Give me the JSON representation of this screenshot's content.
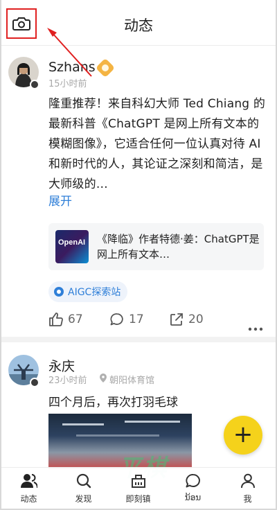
{
  "header": {
    "title": "动态",
    "camera_icon": "camera-icon",
    "highlight_color": "#e02020"
  },
  "posts": [
    {
      "username": "Szhans",
      "timestamp": "15小时前",
      "body": "隆重推荐！来自科幻大师 Ted Chiang 的最新科普《ChatGPT 是网上所有文本的模糊图像》，它适合任何一位认真对待 AI 和新时代的人，其论证之深刻和简洁，是大师级的…",
      "expand_label": "展开",
      "link_card": {
        "thumb_text": "OpenAI",
        "text": "《降临》作者特德·姜：ChatGPT是网上所有文本…"
      },
      "topic": "AIGC探索站",
      "likes": "67",
      "comments": "17",
      "shares": "20"
    },
    {
      "username": "永庆",
      "timestamp": "23小时前",
      "location": "朝阳体育馆",
      "body": "四个月后，再次打羽毛球"
    }
  ],
  "fab": {
    "label": "+"
  },
  "bottom_nav": [
    {
      "label": "动态",
      "icon": "people-icon",
      "active": true
    },
    {
      "label": "发现",
      "icon": "search-icon",
      "active": false
    },
    {
      "label": "即刻镇",
      "icon": "town-icon",
      "active": false
    },
    {
      "label": "ນ້ອນ",
      "icon": "chat-icon",
      "active": false
    },
    {
      "label": "我",
      "icon": "person-icon",
      "active": false
    }
  ],
  "watermark": "平棋",
  "colors": {
    "accent_blue": "#2f7fd8",
    "fab_yellow": "#f5d21b",
    "vip_gold": "#f4b443"
  }
}
